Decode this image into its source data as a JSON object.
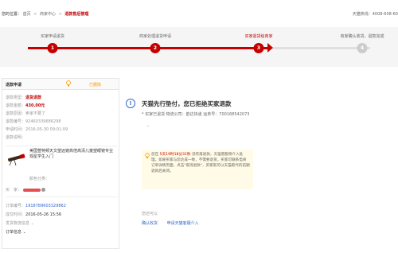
{
  "header": {
    "location_label": "您的位置：",
    "breadcrumbs": [
      "首页",
      "商家中心",
      "退款售后管理"
    ],
    "hotline": "天猫热线：4008-608-60"
  },
  "steps": [
    {
      "label": "买家申请退货",
      "num": "1",
      "state": "done"
    },
    {
      "label": "商家处理退货申请",
      "num": "2",
      "state": "done"
    },
    {
      "label": "买家退货给商家",
      "num": "3",
      "state": "active"
    },
    {
      "label": "商家确认收货，退款完成",
      "num": "4",
      "state": "pending"
    }
  ],
  "progress_fraction": 0.7,
  "left_panel": {
    "title": "退款申请",
    "badge": "已删除",
    "fields": [
      {
        "label": "退款类型：",
        "value": "退货退款",
        "style": "red"
      },
      {
        "label": "退款金额：",
        "value": "430.00元",
        "style": "red"
      },
      {
        "label": "退款原因：",
        "value": "卖家不要了",
        "style": "plain"
      },
      {
        "label": "退款编号：",
        "value": "92460339686298",
        "style": "plain"
      },
      {
        "label": "申请时间：",
        "value": "2016-05-30 09:01:09",
        "style": "plain"
      },
      {
        "label": "退款说明：",
        "value": "",
        "style": "plain"
      }
    ],
    "product_title": "美国萱特频天文望远镜高倍高清儿童望眼镜专业观星学生入门",
    "product_color": "颜色分类：",
    "buyer_label": "买　家：",
    "order_fields": [
      {
        "label": "订单编号：",
        "value": "1918789603329862",
        "style": "blue"
      },
      {
        "label": "成交时间：",
        "value": "2016-05-26 15:56",
        "style": "plain"
      }
    ],
    "ship_info": "发货物流信息 ⌄",
    "order_info": "订单信息 ⌄"
  },
  "right_panel": {
    "title": "天猫先行垫付，您已拒绝买家退款",
    "subtitle": "* 买家已退货 物流公司：韵达快递 运单号：700168542073",
    "expand": "⌄",
    "notice_prefix": "您在 ",
    "notice_highlight": "5天19时18分31秒",
    "notice_rest": " 没有再退款，天猫客服将介入处理。如果买家与您达成一致，不需要退货，买家可联系电商订单详情页面，点击\"取消退款\"，买家就可以天猫取代的前期退款后关闭。",
    "maybe_label": "您还可以",
    "actions": [
      "确认收货",
      "申请天猫客服介入"
    ]
  }
}
